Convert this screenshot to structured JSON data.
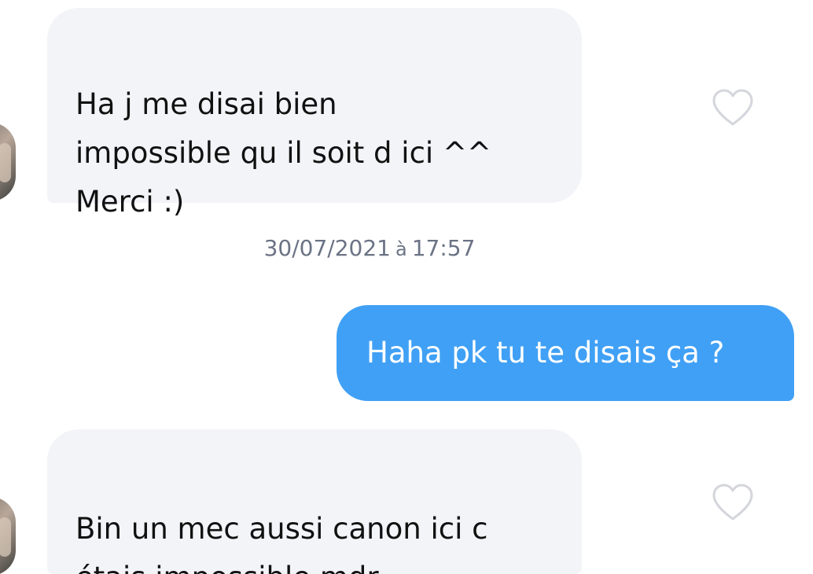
{
  "messages": [
    {
      "direction": "incoming",
      "text": "Ha j me disai bien\nimpossible qu il soit d ici ^^\nMerci :)",
      "liked": false
    },
    {
      "direction": "outgoing",
      "text": "Haha pk tu te disais ça ?"
    },
    {
      "direction": "incoming",
      "text": "Bin un mec aussi canon ici c\nétais impossible mdr",
      "liked": false
    }
  ],
  "timestamp": {
    "date": "30/07/2021",
    "separator": "à",
    "time": "17:57"
  },
  "icons": {
    "like": "heart-outline-icon"
  },
  "colors": {
    "incoming_bubble": "#f3f4f8",
    "outgoing_bubble": "#40a0f5",
    "timestamp_text": "#6b7385",
    "heart_outline": "#d4d6dc"
  }
}
